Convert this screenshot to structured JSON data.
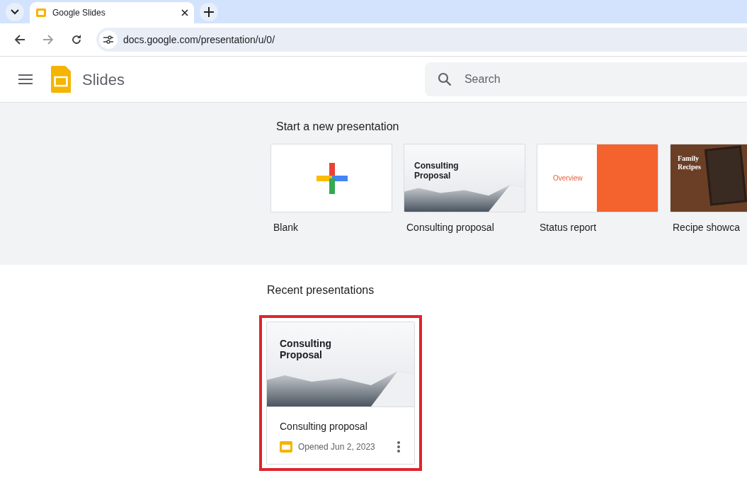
{
  "browser": {
    "tab": {
      "title": "Google Slides",
      "selected": true
    },
    "url": "docs.google.com/presentation/u/0/",
    "forward_disabled": true
  },
  "app": {
    "name": "Slides",
    "search": {
      "placeholder": "Search"
    }
  },
  "templates": {
    "heading": "Start a new presentation",
    "items": [
      {
        "label": "Blank",
        "kind": "blank"
      },
      {
        "label": "Consulting proposal",
        "kind": "consulting",
        "thumb_title": "Consulting Proposal"
      },
      {
        "label": "Status report",
        "kind": "status",
        "thumb_title": "Overview"
      },
      {
        "label": "Recipe showca",
        "kind": "recipe",
        "thumb_title": "Family Recipes"
      }
    ]
  },
  "recent": {
    "heading": "Recent presentations",
    "items": [
      {
        "title": "Consulting proposal",
        "opened": "Opened Jun 2, 2023",
        "thumb_title": "Consulting Proposal",
        "highlighted": true
      }
    ]
  }
}
